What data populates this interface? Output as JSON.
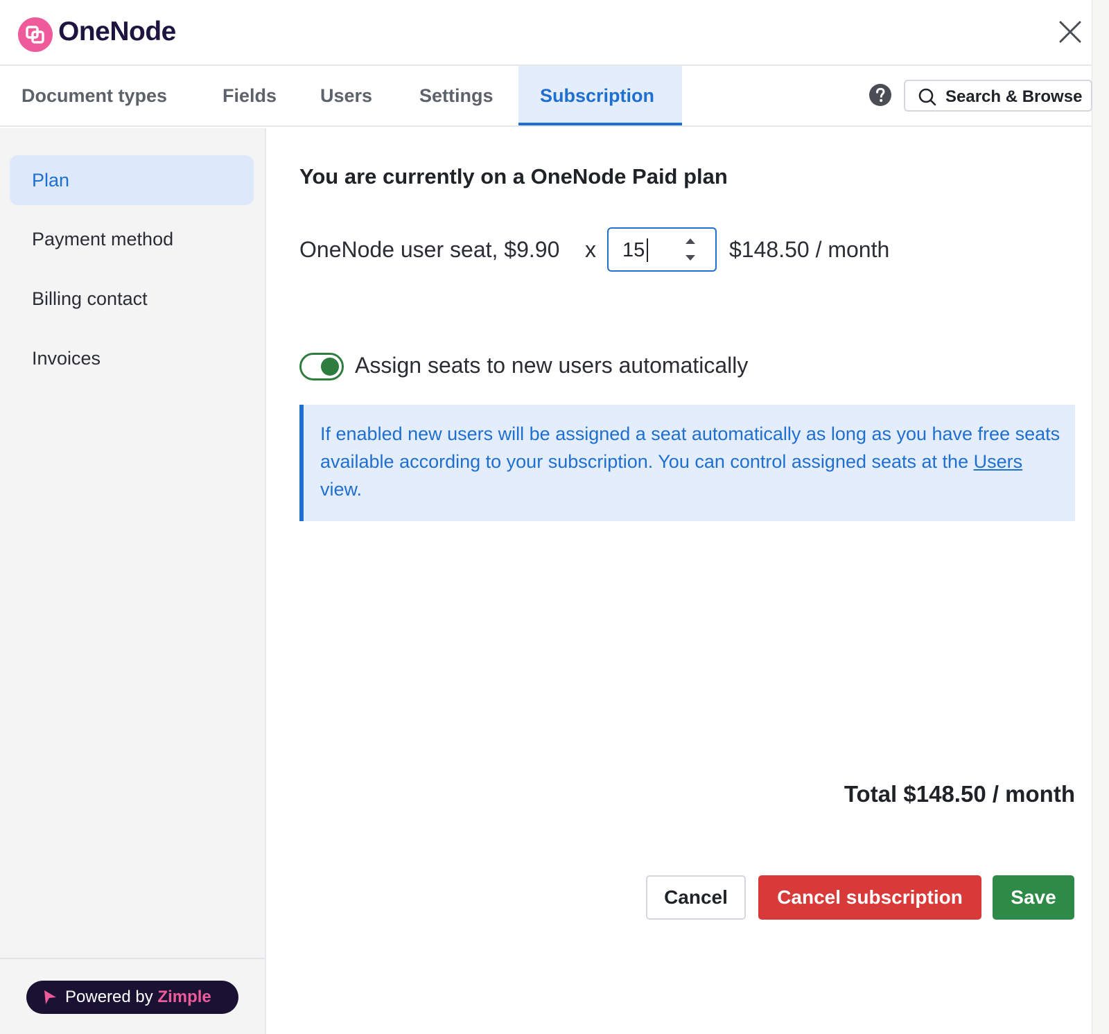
{
  "app": {
    "name": "OneNode",
    "brand_color": "#ef5a9a",
    "accent_color": "#1f6fd1"
  },
  "header": {
    "close_icon": "close-icon"
  },
  "tabs": [
    {
      "label": "Document types",
      "active": false
    },
    {
      "label": "Fields",
      "active": false
    },
    {
      "label": "Users",
      "active": false
    },
    {
      "label": "Settings",
      "active": false
    },
    {
      "label": "Subscription",
      "active": true
    }
  ],
  "toolbar": {
    "help_icon": "help-icon",
    "search_label": "Search & Browse"
  },
  "sidebar": {
    "items": [
      {
        "label": "Plan",
        "active": true
      },
      {
        "label": "Payment method",
        "active": false
      },
      {
        "label": "Billing contact",
        "active": false
      },
      {
        "label": "Invoices",
        "active": false
      }
    ],
    "powered_by": {
      "prefix": "Powered by",
      "brand": "Zimple"
    }
  },
  "main": {
    "plan_title": "You are currently on a OneNode Paid plan",
    "seat": {
      "label": "OneNode user seat, $9.90",
      "multiplier": "x",
      "quantity": "15",
      "price": "$148.50 / month"
    },
    "auto_assign": {
      "enabled": true,
      "label": "Assign seats to new users automatically",
      "toggle_color": "#2e7d3f"
    },
    "info": {
      "text_before": "If enabled new users will be assigned a seat automatically as long as you have free seats available according to your subscription. You can control assigned seats at the ",
      "link": "Users",
      "text_after": " view."
    },
    "total": "Total $148.50 / month",
    "buttons": {
      "cancel": "Cancel",
      "cancel_subscription": "Cancel subscription",
      "save": "Save",
      "danger_color": "#d83a3a",
      "success_color": "#2e8a47"
    }
  }
}
